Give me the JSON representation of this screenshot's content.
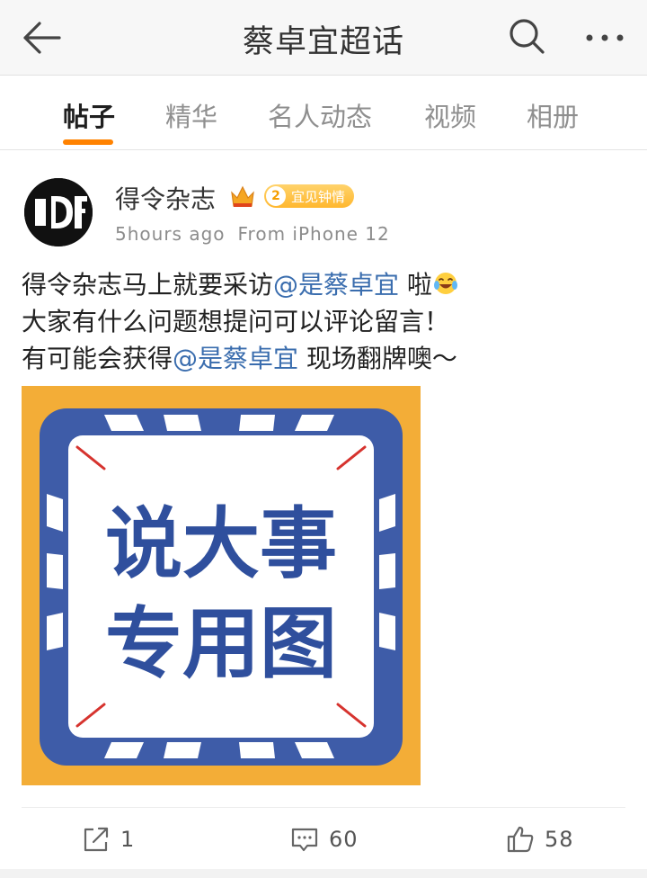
{
  "header": {
    "title": "蔡卓宜超话",
    "back_icon": "arrow-left-icon",
    "search_icon": "search-icon",
    "more_icon": "more-horizontal-icon"
  },
  "tabs": [
    {
      "label": "帖子",
      "active": true
    },
    {
      "label": "精华",
      "active": false
    },
    {
      "label": "名人动态",
      "active": false
    },
    {
      "label": "视频",
      "active": false
    },
    {
      "label": "相册",
      "active": false
    }
  ],
  "post": {
    "author": "得令杂志",
    "fan_badge": {
      "level": "2",
      "text": "宜见钟情"
    },
    "time": "5hours ago",
    "source": "From iPhone 12",
    "lines": [
      {
        "before": "得令杂志马上就要采访",
        "mention": "@是蔡卓宜",
        "after": " 啦"
      },
      {
        "text": "大家有什么问题想提问可以评论留言！"
      },
      {
        "before": "有可能会获得",
        "mention": "@是蔡卓宜",
        "after": " 现场翻牌噢～"
      }
    ],
    "image": {
      "line1": "说大事",
      "line2": "专用图",
      "bg_color": "#f3ad37",
      "frame_color": "#3e5ca8"
    }
  },
  "actions": {
    "repost_count": "1",
    "comment_count": "60",
    "like_count": "58"
  },
  "colors": {
    "accent": "#ff8200",
    "mention": "#3a6dae"
  }
}
